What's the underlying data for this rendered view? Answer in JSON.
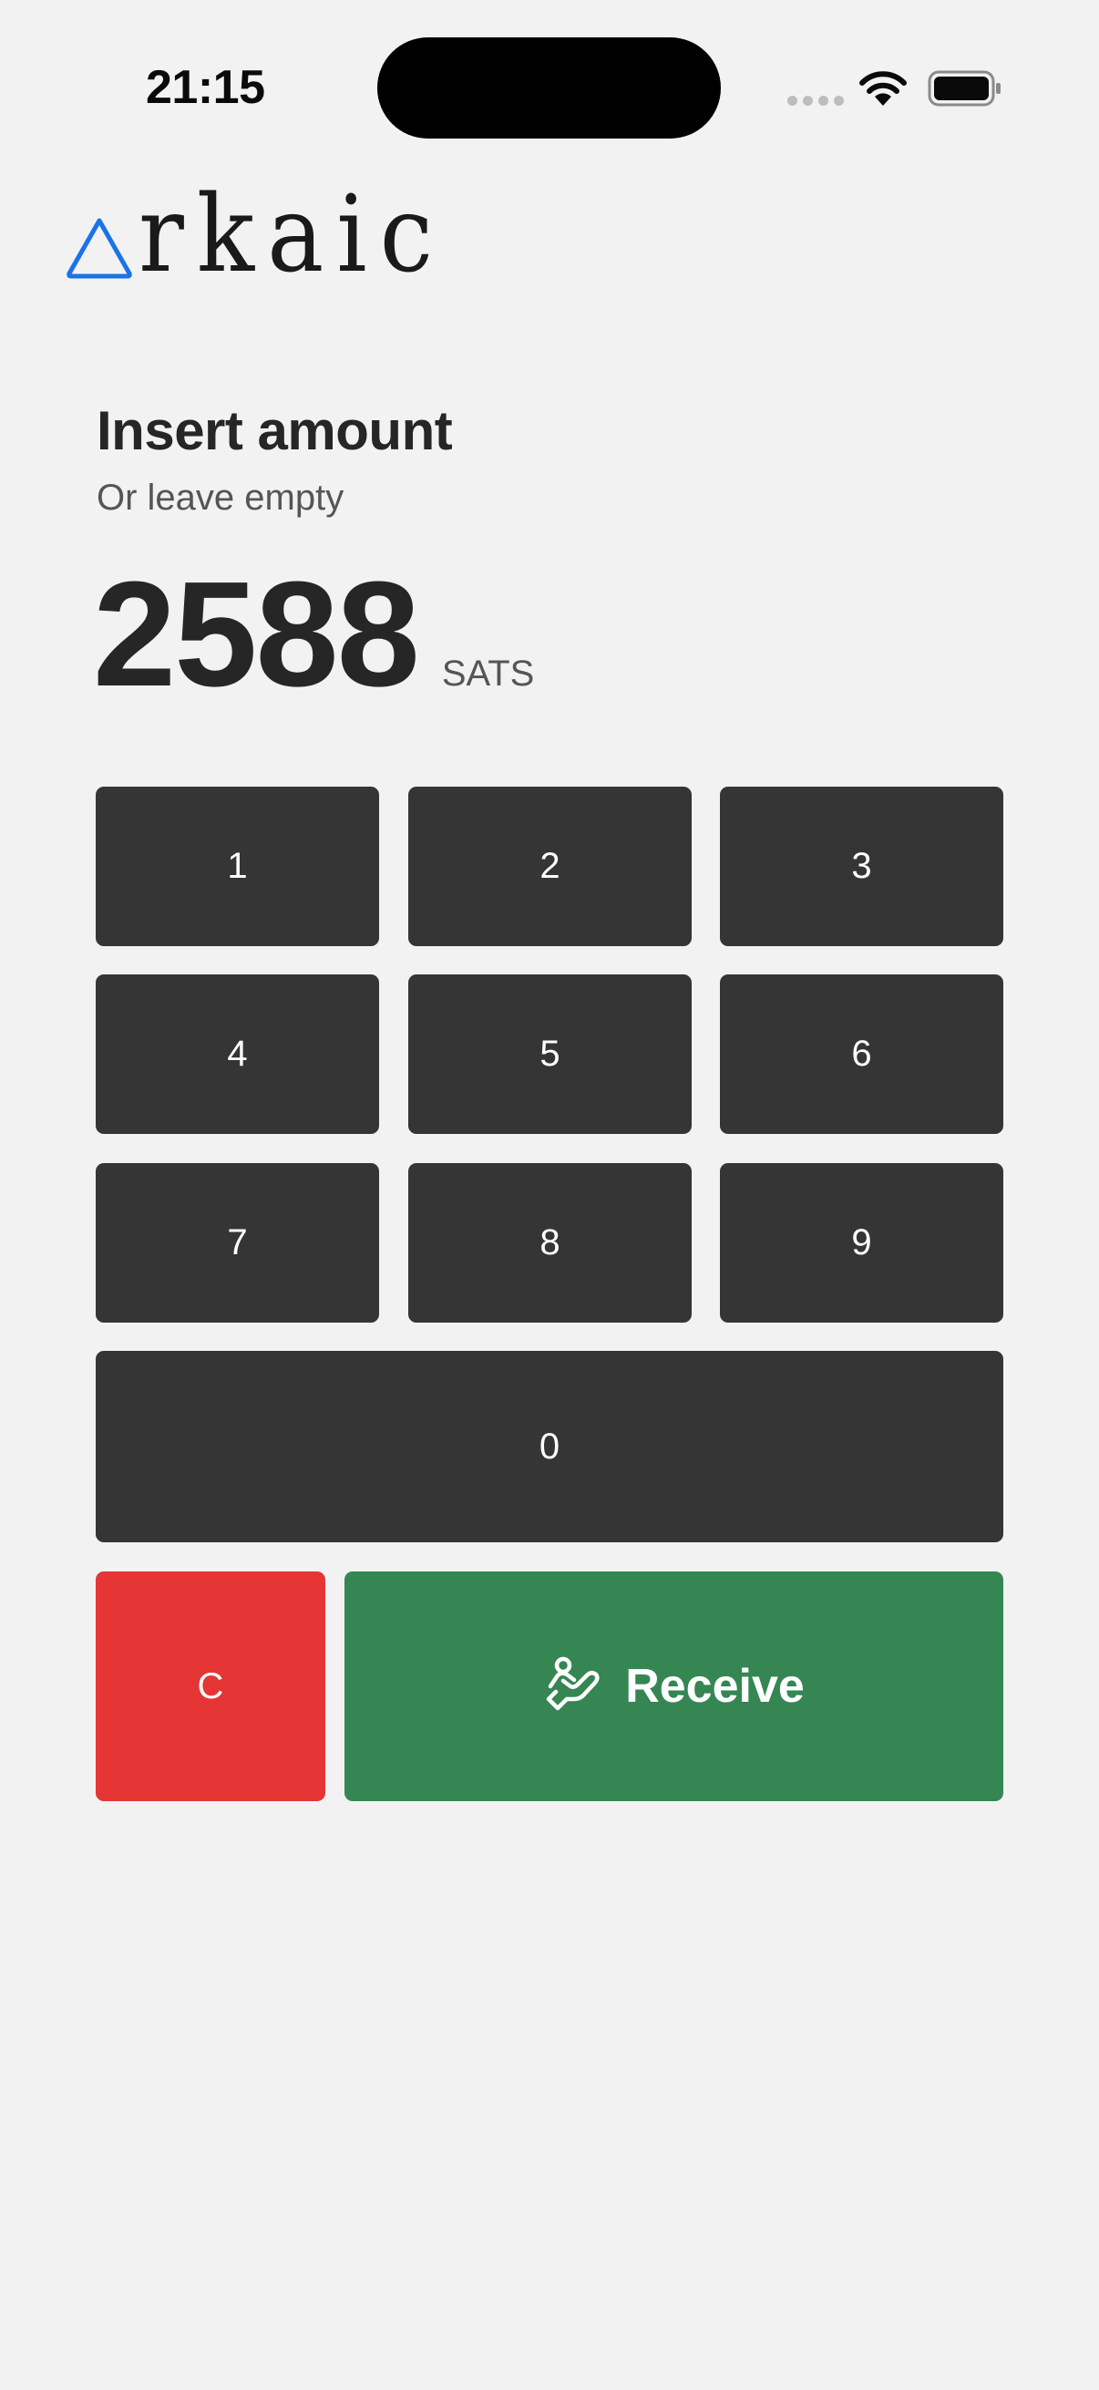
{
  "status_bar": {
    "time": "21:15"
  },
  "logo": {
    "text": "rkaic",
    "accent_color": "#1a73e8"
  },
  "prompt": {
    "title": "Insert amount",
    "subtitle": "Or leave empty"
  },
  "amount": {
    "value": "2588",
    "unit": "SATS"
  },
  "keypad": {
    "keys": [
      "1",
      "2",
      "3",
      "4",
      "5",
      "6",
      "7",
      "8",
      "9",
      "0"
    ],
    "clear_label": "C",
    "receive_label": "Receive",
    "receive_icon": "hand-receive-icon"
  },
  "colors": {
    "background": "#f2f2f2",
    "key": "#353535",
    "clear": "#e53535",
    "receive": "#358653"
  }
}
